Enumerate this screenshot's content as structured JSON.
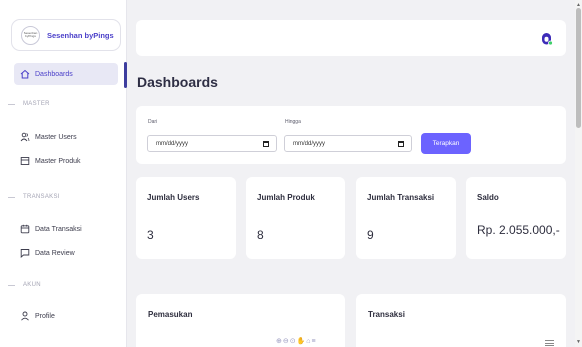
{
  "brand": {
    "name": "Sesenhan byPings",
    "logo_text": "Sesenhan byPings"
  },
  "sidebar": {
    "items": [
      {
        "label": "Dashboards",
        "icon": "home-icon"
      },
      {
        "label": "Master Users",
        "icon": "users-icon"
      },
      {
        "label": "Master Produk",
        "icon": "box-icon"
      },
      {
        "label": "Data Transaksi",
        "icon": "calendar-icon"
      },
      {
        "label": "Data Review",
        "icon": "chat-icon"
      },
      {
        "label": "Profile",
        "icon": "user-icon"
      }
    ],
    "sections": {
      "master": "MASTER",
      "transaksi": "TRANSAKSI",
      "akun": "AKUN"
    }
  },
  "main": {
    "title": "Dashboards",
    "filter": {
      "from_label": "Dari",
      "from_value": "mm/dd/yyyy",
      "to_label": "Hingga",
      "to_value": "mm/dd/yyyy",
      "apply_label": "Terapkan"
    },
    "stats": [
      {
        "label": "Jumlah Users",
        "value": "3"
      },
      {
        "label": "Jumlah Produk",
        "value": "8"
      },
      {
        "label": "Jumlah Transaksi",
        "value": "9"
      },
      {
        "label": "Saldo",
        "value": "Rp. 2.055.000,-"
      }
    ],
    "charts": {
      "income_title": "Pemasukan",
      "transactions_title": "Transaksi"
    }
  },
  "colors": {
    "accent": "#6c63ff",
    "brand": "#4a3fc9",
    "background": "#f1f1f4"
  }
}
